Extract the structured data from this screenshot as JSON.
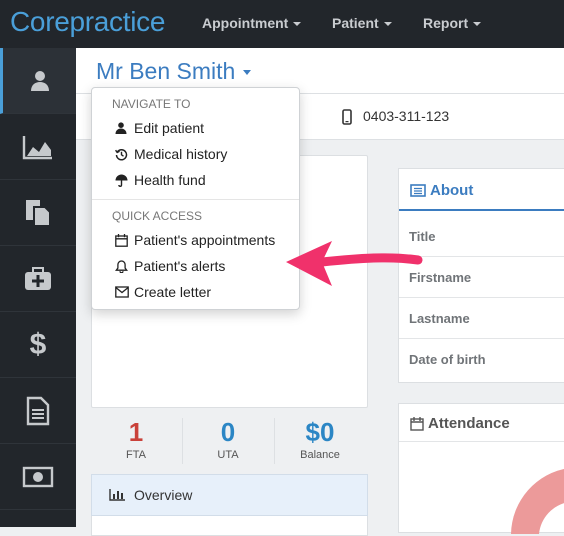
{
  "app": {
    "logo": "Corepractice"
  },
  "topnav": [
    {
      "label": "Appointment"
    },
    {
      "label": "Patient"
    },
    {
      "label": "Report"
    }
  ],
  "sidebar": [
    {
      "icon": "user-icon"
    },
    {
      "icon": "area-chart-icon"
    },
    {
      "icon": "documents-icon"
    },
    {
      "icon": "medical-kit-icon"
    },
    {
      "icon": "dollar-icon"
    },
    {
      "icon": "file-text-icon"
    },
    {
      "icon": "money-icon"
    }
  ],
  "patient": {
    "name": "Mr Ben Smith",
    "phone": "0403-311-123"
  },
  "dropdown": {
    "navigate_header": "NAVIGATE TO",
    "navigate_items": [
      {
        "label": "Edit patient",
        "icon": "user-icon"
      },
      {
        "label": "Medical history",
        "icon": "history-icon"
      },
      {
        "label": "Health fund",
        "icon": "umbrella-icon"
      }
    ],
    "quick_header": "QUICK ACCESS",
    "quick_items": [
      {
        "label": "Patient's appointments",
        "icon": "calendar-icon"
      },
      {
        "label": "Patient's alerts",
        "icon": "bell-icon"
      },
      {
        "label": "Create letter",
        "icon": "envelope-icon"
      }
    ]
  },
  "stats": [
    {
      "value": "1",
      "label": "FTA",
      "color": "#c9413a"
    },
    {
      "value": "0",
      "label": "UTA",
      "color": "#2b86c5"
    },
    {
      "value": "$0",
      "label": "Balance",
      "color": "#2b86c5"
    }
  ],
  "overview": {
    "label": "Overview"
  },
  "about": {
    "title": "About",
    "rows": [
      "Title",
      "Firstname",
      "Lastname",
      "Date of birth"
    ]
  },
  "attendance": {
    "title": "Attendance"
  },
  "colors": {
    "accent": "#3b7cc0",
    "sidebar_bg": "#22262b",
    "arrow": "#f0316b"
  }
}
